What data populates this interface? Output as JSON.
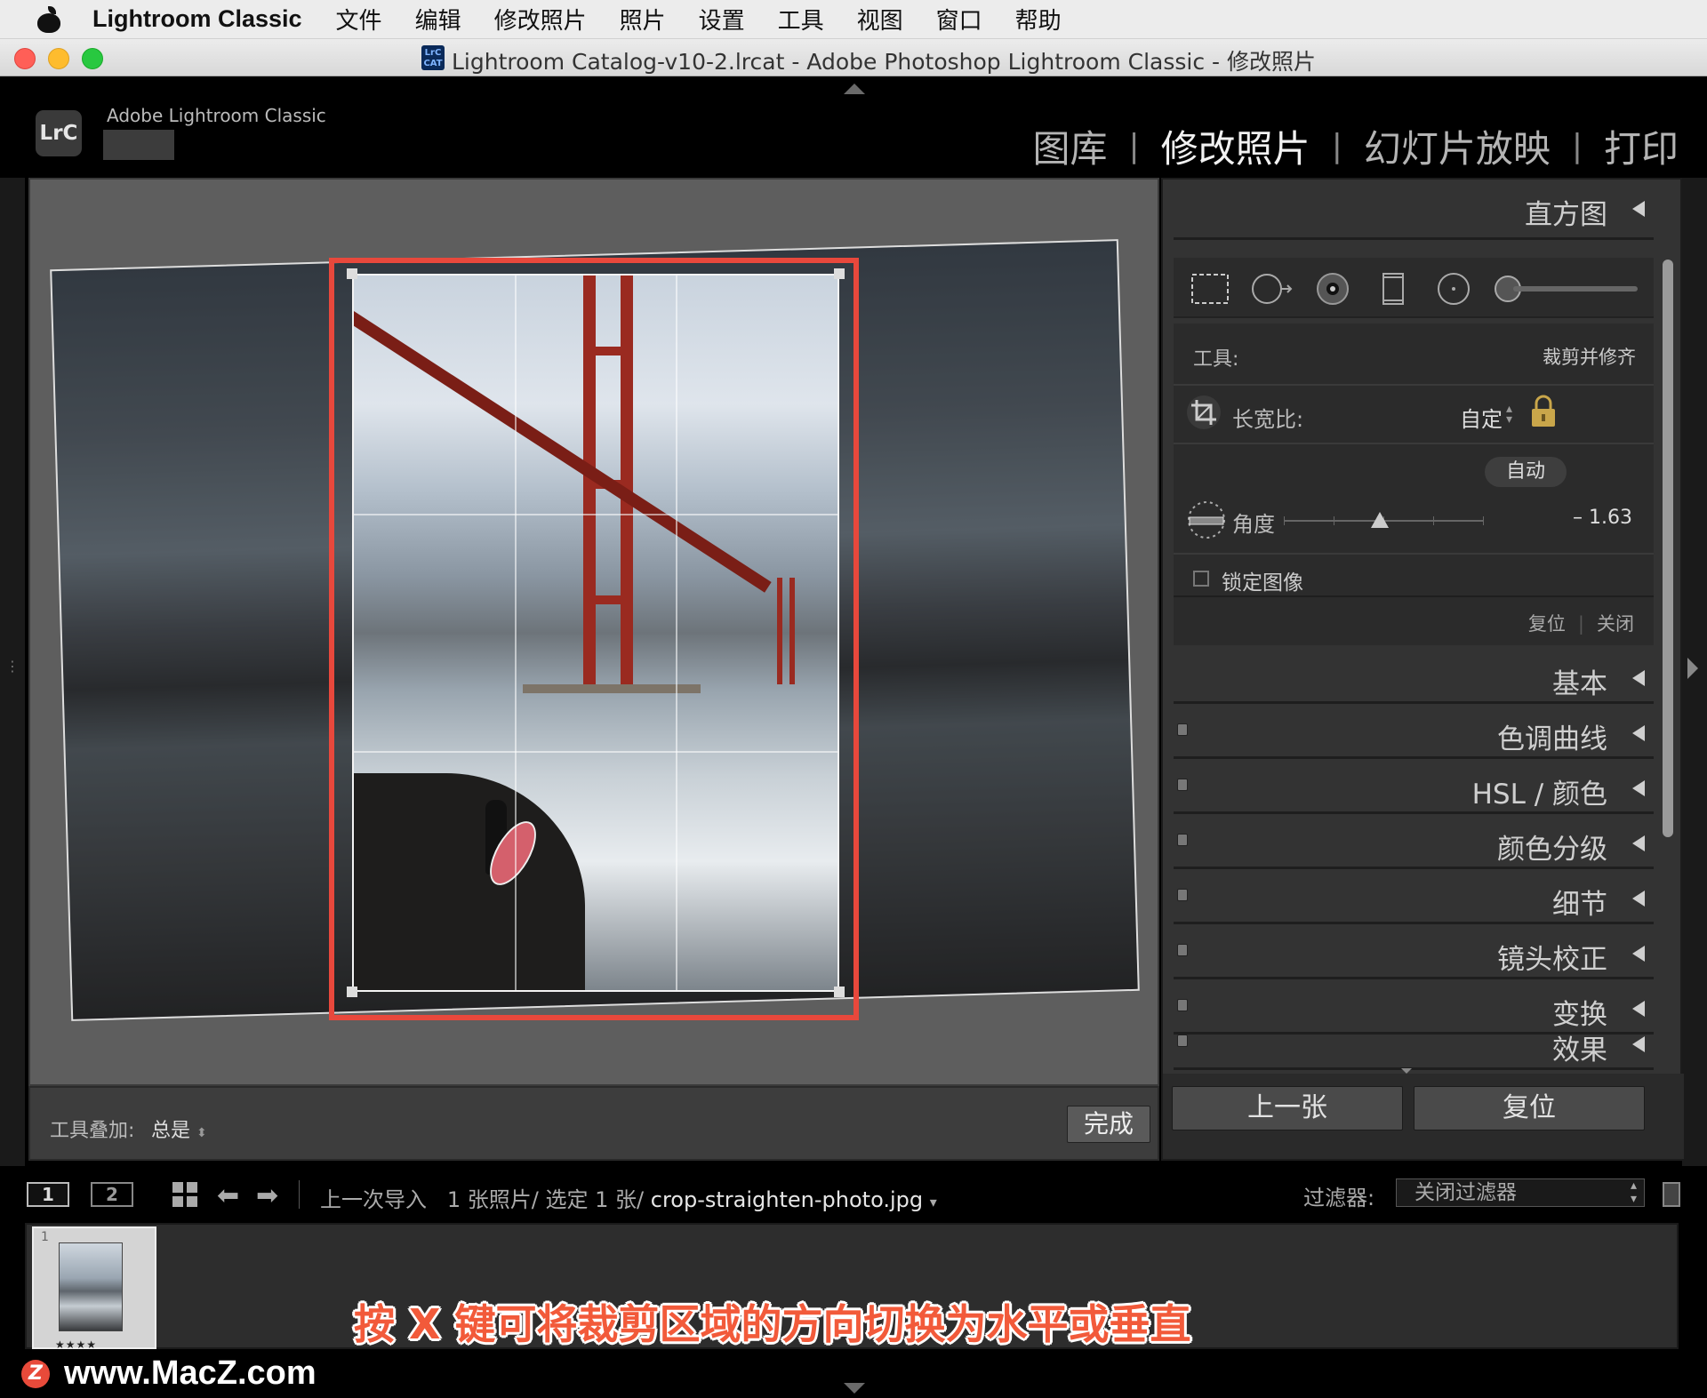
{
  "menubar": {
    "app_name": "Lightroom Classic",
    "items": [
      "文件",
      "编辑",
      "修改照片",
      "照片",
      "设置",
      "工具",
      "视图",
      "窗口",
      "帮助"
    ]
  },
  "window": {
    "title": "Lightroom Catalog-v10-2.lrcat - Adobe Photoshop Lightroom Classic - 修改照片",
    "icon_text": "LrC CAT"
  },
  "header": {
    "logo_text": "LrC",
    "product_name": "Adobe Lightroom Classic",
    "modules": [
      {
        "label": "图库",
        "active": false
      },
      {
        "label": "修改照片",
        "active": true
      },
      {
        "label": "幻灯片放映",
        "active": false
      },
      {
        "label": "打印",
        "active": false
      }
    ],
    "separator": "|"
  },
  "image_toolbar": {
    "tool_overlay_label": "工具叠加:",
    "tool_overlay_value": "总是",
    "done_label": "完成"
  },
  "right_panel": {
    "histogram_label": "直方图",
    "tool_strip_icons": [
      "crop-overlay-icon",
      "spot-removal-icon",
      "red-eye-icon",
      "graduated-filter-icon",
      "radial-filter-icon",
      "adjustment-brush-icon"
    ],
    "crop": {
      "tool_label": "工具:",
      "tool_value": "裁剪并修齐",
      "aspect_label": "长宽比:",
      "aspect_value": "自定",
      "auto_label": "自动",
      "angle_label": "角度",
      "angle_value": "– 1.63",
      "angle_range": [
        -45,
        45
      ],
      "lock_image_label": "锁定图像",
      "reset_label": "复位",
      "close_label": "关闭"
    },
    "sections": [
      "基本",
      "色调曲线",
      "HSL / 颜色",
      "颜色分级",
      "细节",
      "镜头校正",
      "变换",
      "效果"
    ],
    "prev_button": "上一张",
    "reset_button": "复位"
  },
  "filmbar": {
    "view1": "1",
    "view2": "2",
    "crumb_source": "上一次导入",
    "crumb_count": "1 张照片/ 选定 1 张/",
    "crumb_file": "crop-straighten-photo.jpg",
    "filter_label": "过滤器:",
    "filter_value": "关闭过滤器"
  },
  "filmstrip": {
    "thumb_index": "1",
    "thumb_stars": "★★★★"
  },
  "caption": "按 X 键可将裁剪区域的方向切换为水平或垂直",
  "watermark": {
    "logo": "Z",
    "text": "www.MacZ.com"
  },
  "colors": {
    "highlight": "#e8483c",
    "caption": "#f25a3a",
    "panel_bg": "#333333",
    "app_bg": "#000000"
  }
}
